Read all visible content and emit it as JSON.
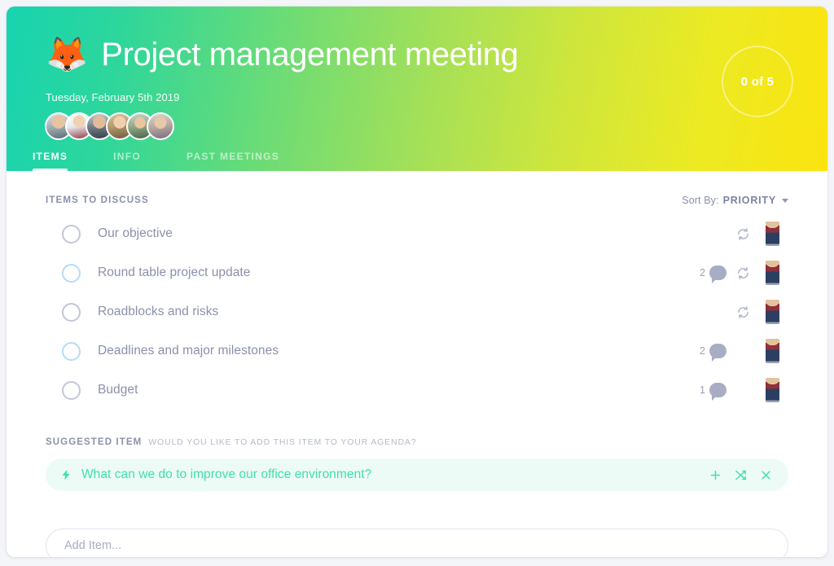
{
  "header": {
    "emoji": "🦊",
    "title": "Project management meeting",
    "date": "Tuesday, February 5th 2019",
    "counter": "0 of 5",
    "gradient_start": "#17d4b0",
    "gradient_end": "#fbe40f",
    "participants": [
      {
        "name": "participant-1"
      },
      {
        "name": "participant-2"
      },
      {
        "name": "participant-3"
      },
      {
        "name": "participant-4"
      },
      {
        "name": "participant-5"
      },
      {
        "name": "participant-6"
      }
    ]
  },
  "tabs": [
    {
      "label": "ITEMS",
      "active": true
    },
    {
      "label": "INFO",
      "active": false
    },
    {
      "label": "PAST MEETINGS",
      "active": false
    }
  ],
  "main": {
    "section_title": "ITEMS TO DISCUSS",
    "sort": {
      "label": "Sort By:",
      "value": "PRIORITY",
      "caret_icon": "chevron-down-icon"
    },
    "items": [
      {
        "label": "Our objective",
        "checked": false,
        "check_style": "gray",
        "comments": "",
        "has_comments": false,
        "recurring": true,
        "avatar": "assignee-avatar"
      },
      {
        "label": "Round table project update",
        "checked": false,
        "check_style": "blue",
        "comments": "2",
        "has_comments": true,
        "recurring": true,
        "avatar": "assignee-avatar"
      },
      {
        "label": "Roadblocks and risks",
        "checked": false,
        "check_style": "gray",
        "comments": "",
        "has_comments": false,
        "recurring": true,
        "avatar": "assignee-avatar"
      },
      {
        "label": "Deadlines and major milestones",
        "checked": false,
        "check_style": "blue",
        "comments": "2",
        "has_comments": true,
        "recurring": false,
        "avatar": "assignee-avatar"
      },
      {
        "label": "Budget",
        "checked": false,
        "check_style": "gray",
        "comments": "1",
        "has_comments": true,
        "recurring": false,
        "avatar": "assignee-avatar"
      }
    ]
  },
  "suggested": {
    "title": "SUGGESTED ITEM",
    "subtitle": "WOULD YOU LIKE TO ADD THIS ITEM TO YOUR AGENDA?",
    "text": "What can we do to improve our office environment?",
    "bolt_icon": "lightning-bolt-icon",
    "accent_color": "#3fe0ab",
    "background_color": "#edfbf6",
    "actions": [
      {
        "icon": "plus-icon",
        "name": "add-suggested-item"
      },
      {
        "icon": "shuffle-icon",
        "name": "shuffle-suggested-item"
      },
      {
        "icon": "close-icon",
        "name": "dismiss-suggested-item"
      }
    ]
  },
  "add_item": {
    "placeholder": "Add Item...",
    "value": ""
  }
}
